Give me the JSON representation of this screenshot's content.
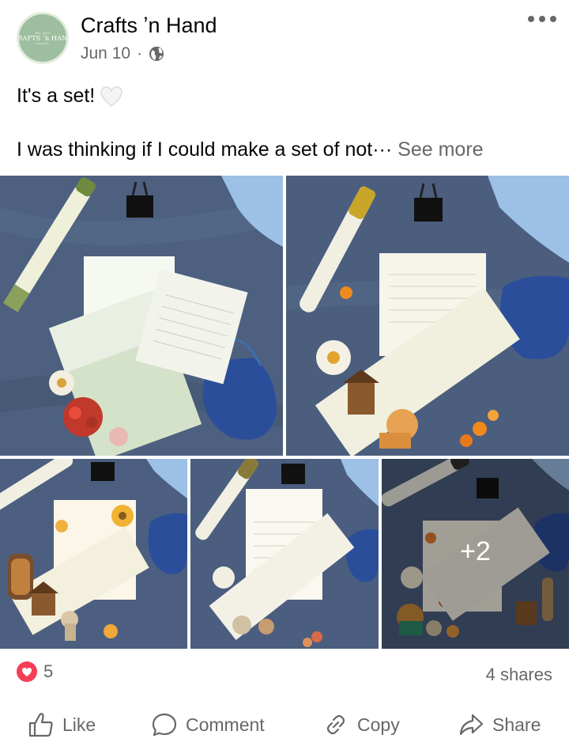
{
  "post": {
    "page_name": "Crafts ʼn Hand",
    "date": "Jun 10",
    "separator": "·",
    "audience_icon": "globe-icon",
    "avatar": {
      "top_text": "Est. 2023",
      "logo_text": "CRAFTS ʼn HAND",
      "sub_text": "handmade"
    },
    "text_line1": "It's a set!",
    "text_line1_emoji": "white-heart",
    "text_line2": "I was thinking if I could make a set of not",
    "ellipsis": "···",
    "see_more": "See more",
    "more_icon": "more-options-icon"
  },
  "photos": {
    "items": [
      {
        "label": "photo-1",
        "theme": "green notes set"
      },
      {
        "label": "photo-2",
        "theme": "orange flowers bookmark"
      },
      {
        "label": "photo-3",
        "theme": "sunflower notes"
      },
      {
        "label": "photo-4",
        "theme": "lined notes"
      },
      {
        "label": "photo-5",
        "theme": "autumn flowers set"
      }
    ],
    "more_count": "+2"
  },
  "reactions": {
    "icon": "love-icon",
    "count": "5",
    "shares": "4 shares"
  },
  "actions": {
    "like": "Like",
    "comment": "Comment",
    "copy": "Copy",
    "share": "Share"
  },
  "colors": {
    "text": "#050505",
    "secondary": "#65676b",
    "love": "#f33e58",
    "denim": "#4a5f7e"
  }
}
